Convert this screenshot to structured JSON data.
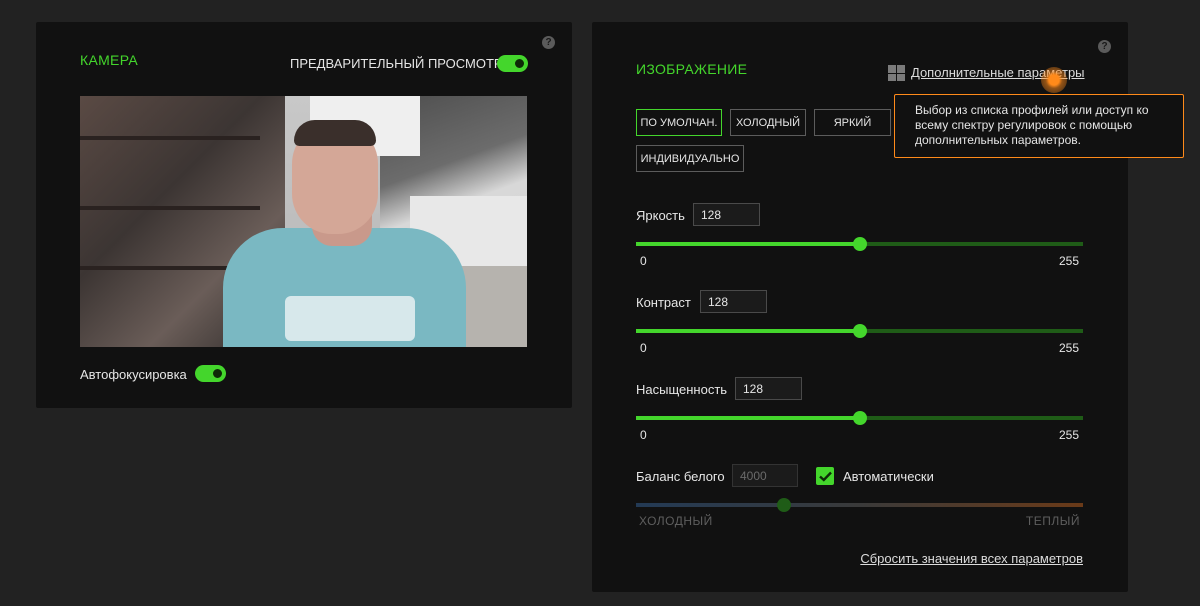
{
  "camera_panel": {
    "title": "КАМЕРА",
    "preview_label": "ПРЕДВАРИТЕЛЬНЫЙ ПРОСМОТР",
    "preview_toggle": true,
    "autofocus_label": "Автофокусировка",
    "autofocus_toggle": true,
    "help_glyph": "?"
  },
  "image_panel": {
    "title": "ИЗОБРАЖЕНИЕ",
    "help_glyph": "?",
    "advanced_link": "Дополнительные параметры",
    "tooltip": "Выбор из списка профилей или доступ ко всему спектру регулировок с помощью дополнительных параметров.",
    "profiles": [
      {
        "label": "ПО УМОЛЧАН.",
        "active": true
      },
      {
        "label": "ХОЛОДНЫЙ",
        "active": false
      },
      {
        "label": "ЯРКИЙ",
        "active": false
      },
      {
        "label": "ИНДИВИДУАЛЬНО",
        "active": false
      }
    ],
    "sliders": [
      {
        "label": "Яркость",
        "value": "128",
        "min": "0",
        "max": "255"
      },
      {
        "label": "Контраст",
        "value": "128",
        "min": "0",
        "max": "255"
      },
      {
        "label": "Насыщенность",
        "value": "128",
        "min": "0",
        "max": "255"
      }
    ],
    "white_balance": {
      "label": "Баланс белого",
      "value": "4000",
      "auto_label": "Автоматически",
      "auto_checked": true,
      "cold_label": "ХОЛОДНЫЙ",
      "warm_label": "ТЕПЛЫЙ",
      "level_fraction": 0.33
    },
    "reset_link": "Сбросить значения всех параметров"
  },
  "colors": {
    "accent": "#44d62c",
    "tooltip_border": "#ff8a1a",
    "panel_bg": "#111111",
    "page_bg": "#222222"
  },
  "icons": [
    "help-icon",
    "windows-icon",
    "checkmark-icon"
  ]
}
